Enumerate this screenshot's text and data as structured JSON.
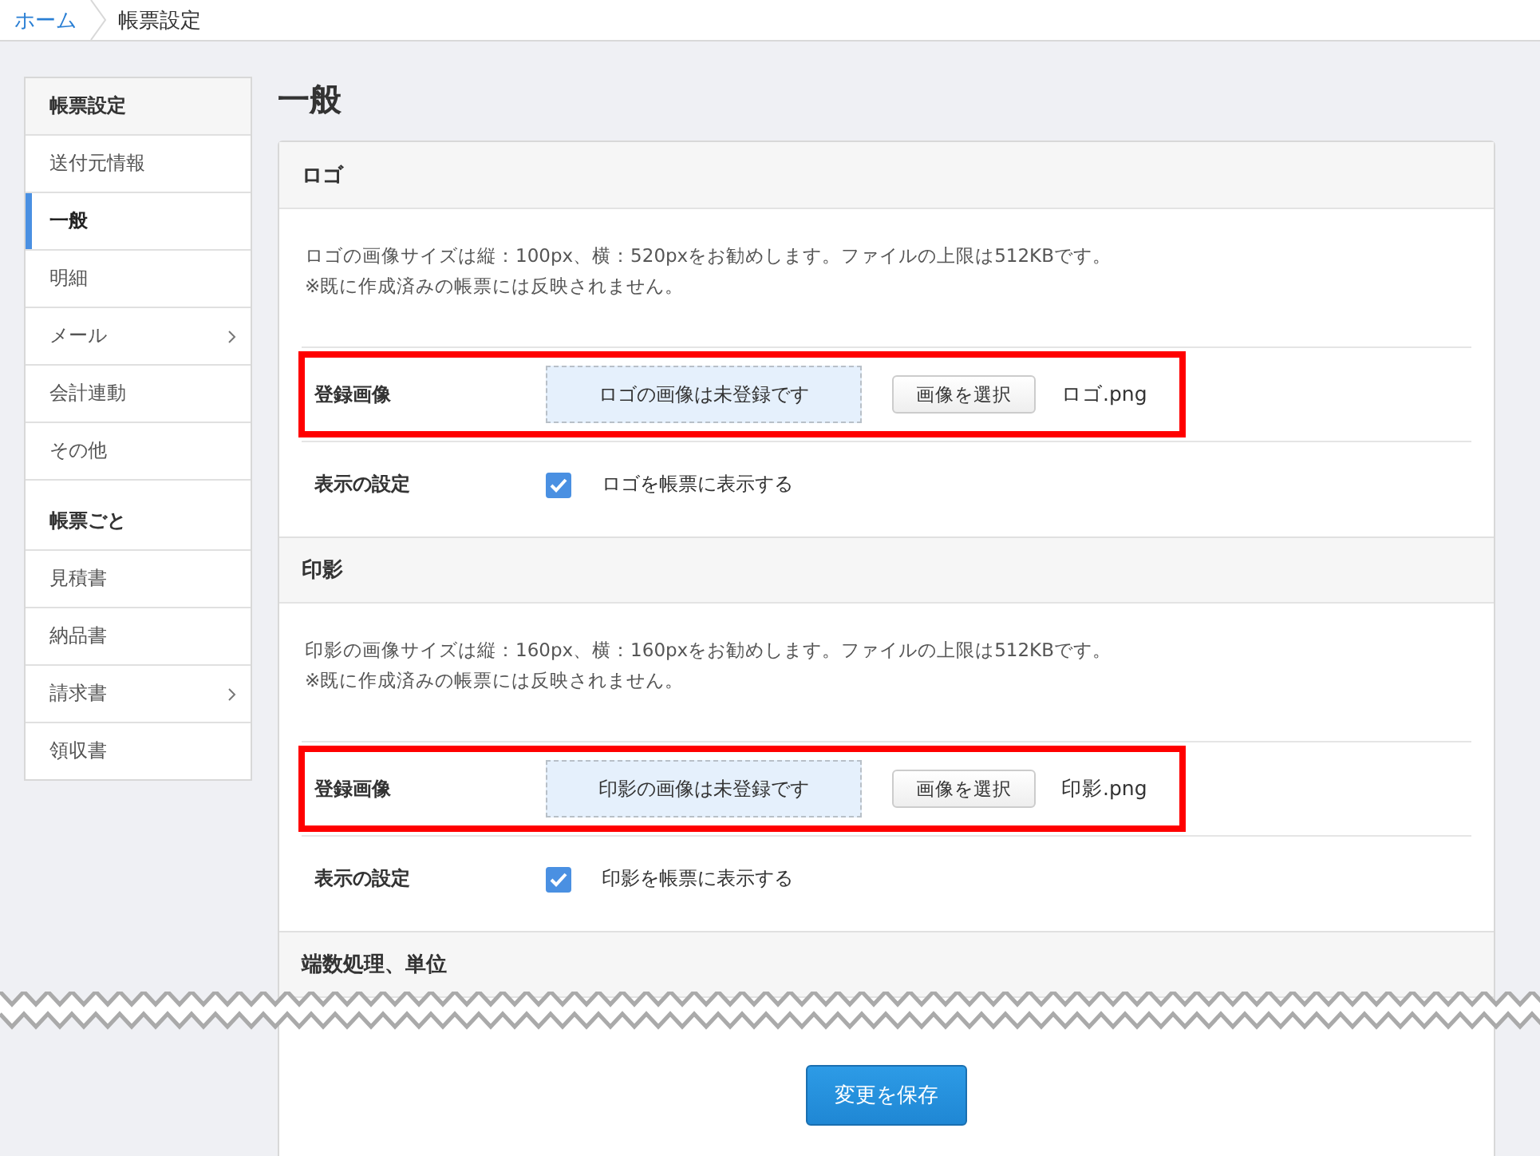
{
  "breadcrumb": [
    {
      "label": "ホーム",
      "link": true
    },
    {
      "label": "帳票設定",
      "link": false
    }
  ],
  "sidebar": {
    "groups": [
      {
        "heading": "帳票設定",
        "items": [
          {
            "label": "送付元情報",
            "selected": false,
            "submenu": false
          },
          {
            "label": "一般",
            "selected": true,
            "submenu": false
          },
          {
            "label": "明細",
            "selected": false,
            "submenu": false
          },
          {
            "label": "メール",
            "selected": false,
            "submenu": true
          },
          {
            "label": "会計連動",
            "selected": false,
            "submenu": false
          },
          {
            "label": "その他",
            "selected": false,
            "submenu": false
          }
        ]
      },
      {
        "heading": "帳票ごと",
        "items": [
          {
            "label": "見積書",
            "selected": false,
            "submenu": false
          },
          {
            "label": "納品書",
            "selected": false,
            "submenu": false
          },
          {
            "label": "請求書",
            "selected": false,
            "submenu": true
          },
          {
            "label": "領収書",
            "selected": false,
            "submenu": false
          }
        ]
      }
    ]
  },
  "page_title": "一般",
  "sections": [
    {
      "title": "ロゴ",
      "description": [
        "ロゴの画像サイズは縦：100px、横：520pxをお勧めします。ファイルの上限は512KBです。",
        "※既に作成済みの帳票には反映されません。"
      ],
      "rows": [
        {
          "kind": "image",
          "label": "登録画像",
          "drop_zone_text": "ロゴの画像は未登録です",
          "button": "画像を選択",
          "file_name": "ロゴ.png",
          "highlighted": true
        },
        {
          "kind": "checkbox",
          "label": "表示の設定",
          "checked": true,
          "text": "ロゴを帳票に表示する"
        }
      ]
    },
    {
      "title": "印影",
      "description": [
        "印影の画像サイズは縦：160px、横：160pxをお勧めします。ファイルの上限は512KBです。",
        "※既に作成済みの帳票には反映されません。"
      ],
      "rows": [
        {
          "kind": "image",
          "label": "登録画像",
          "drop_zone_text": "印影の画像は未登録です",
          "button": "画像を選択",
          "file_name": "印影.png",
          "highlighted": true
        },
        {
          "kind": "checkbox",
          "label": "表示の設定",
          "checked": true,
          "text": "印影を帳票に表示する"
        }
      ]
    },
    {
      "title": "端数処理、単位"
    }
  ],
  "save_button": "変更を保存"
}
